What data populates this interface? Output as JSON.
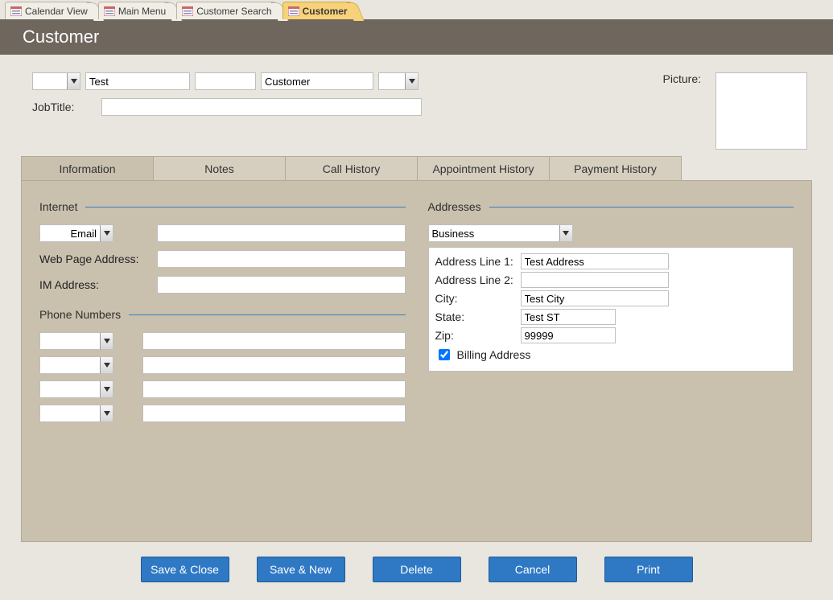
{
  "tabs": [
    {
      "label": "Calendar View",
      "active": false
    },
    {
      "label": "Main Menu",
      "active": false
    },
    {
      "label": "Customer Search",
      "active": false
    },
    {
      "label": "Customer",
      "active": true
    }
  ],
  "header": {
    "title": "Customer"
  },
  "upper": {
    "prefix": "",
    "first_name": "Test",
    "middle": "",
    "last_name": "Customer",
    "suffix": "",
    "jobtitle_label": "JobTitle:",
    "jobtitle": "",
    "picture_label": "Picture:"
  },
  "subtabs": [
    {
      "label": "Information",
      "active": true
    },
    {
      "label": "Notes",
      "active": false
    },
    {
      "label": "Call History",
      "active": false
    },
    {
      "label": "Appointment History",
      "active": false
    },
    {
      "label": "Payment History",
      "active": false
    }
  ],
  "internet": {
    "group_label": "Internet",
    "contact_type": "Email",
    "contact_value": "",
    "web_label": "Web Page Address:",
    "web_value": "",
    "im_label": "IM Address:",
    "im_value": ""
  },
  "phones": {
    "group_label": "Phone Numbers",
    "rows": [
      {
        "type": "",
        "number": ""
      },
      {
        "type": "",
        "number": ""
      },
      {
        "type": "",
        "number": ""
      },
      {
        "type": "",
        "number": ""
      }
    ]
  },
  "addresses": {
    "group_label": "Addresses",
    "type": "Business",
    "line1_label": "Address Line 1:",
    "line1": "Test Address",
    "line2_label": "Address Line 2:",
    "line2": "",
    "city_label": "City:",
    "city": "Test City",
    "state_label": "State:",
    "state": "Test ST",
    "zip_label": "Zip:",
    "zip": "99999",
    "billing_label": "Billing Address",
    "billing_checked": true
  },
  "buttons": {
    "save_close": "Save & Close",
    "save_new": "Save & New",
    "delete": "Delete",
    "cancel": "Cancel",
    "print": "Print"
  }
}
